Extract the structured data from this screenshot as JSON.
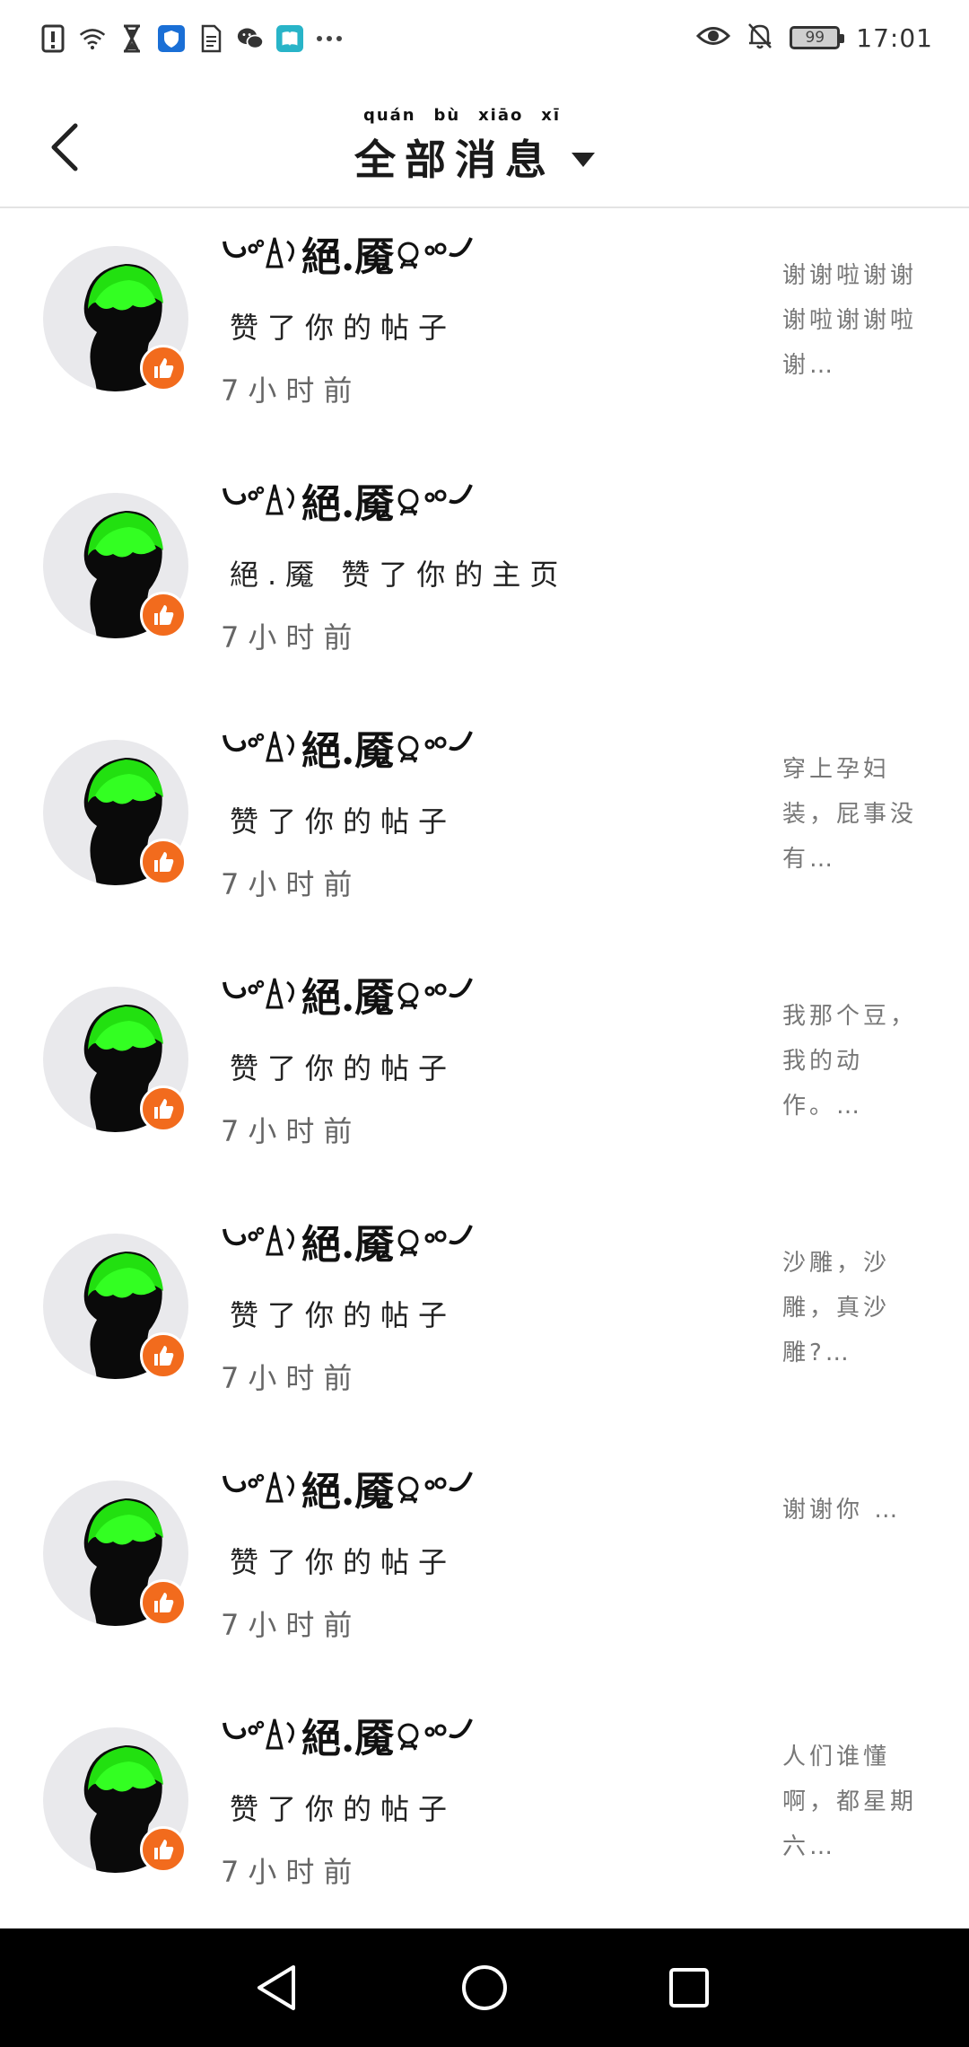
{
  "status_bar": {
    "time": "17:01",
    "battery": "99",
    "left_icons": [
      "alert-icon",
      "wifi-icon",
      "hourglass-icon",
      "shield-app-icon",
      "document-icon",
      "wechat-icon",
      "book-app-icon",
      "more-dots-icon"
    ],
    "right_icons": [
      "eye-icon",
      "bell-off-icon",
      "battery-icon"
    ]
  },
  "header": {
    "title": "全部消息",
    "title_pinyin": [
      "quán",
      "bù",
      "xiāo",
      "xī"
    ]
  },
  "accent_color": "#f26b1d",
  "notifications": [
    {
      "username": "絕.魇",
      "action": "赞了你的帖子",
      "time": "7小时前",
      "preview": "谢谢啦谢谢谢啦谢谢啦谢…"
    },
    {
      "username": "絕.魇",
      "action": "絕.魇 赞了你的主页",
      "time": "7小时前",
      "preview": ""
    },
    {
      "username": "絕.魇",
      "action": "赞了你的帖子",
      "time": "7小时前",
      "preview": "穿上孕妇装，屁事没有…"
    },
    {
      "username": "絕.魇",
      "action": "赞了你的帖子",
      "time": "7小时前",
      "preview": "我那个豆，我的动作。…"
    },
    {
      "username": "絕.魇",
      "action": "赞了你的帖子",
      "time": "7小时前",
      "preview": "沙雕，沙雕，真沙雕?…"
    },
    {
      "username": "絕.魇",
      "action": "赞了你的帖子",
      "time": "7小时前",
      "preview": "谢谢你 …"
    },
    {
      "username": "絕.魇",
      "action": "赞了你的帖子",
      "time": "7小时前",
      "preview": "人们谁懂啊，都星期六…"
    }
  ],
  "nav_bar": {
    "buttons": [
      "back-nav-icon",
      "home-nav-icon",
      "recents-nav-icon"
    ]
  }
}
